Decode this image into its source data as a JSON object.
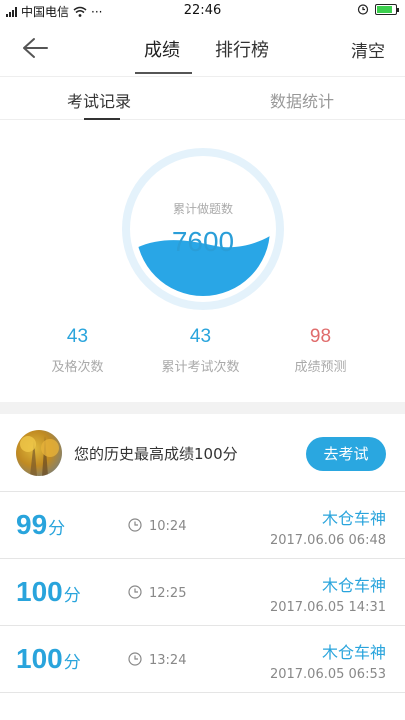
{
  "status_bar": {
    "carrier": "中国电信",
    "time": "22:46"
  },
  "nav": {
    "tabs": [
      "成绩",
      "排行榜"
    ],
    "active_tab": "成绩",
    "clear_label": "清空"
  },
  "subtabs": {
    "items": [
      "考试记录",
      "数据统计"
    ],
    "active": "考试记录"
  },
  "gauge": {
    "label": "累计做题数",
    "value": "7600",
    "accent": "#2a9ed8"
  },
  "stats": [
    {
      "value": "43",
      "caption": "及格次数"
    },
    {
      "value": "43",
      "caption": "累计考试次数"
    },
    {
      "value": "98",
      "caption": "成绩预测"
    }
  ],
  "best": {
    "text": "您的历史最高成绩100分",
    "button": "去考试"
  },
  "records": [
    {
      "score": "99",
      "unit": "分",
      "duration": "10:24",
      "name": "木仓车神",
      "date": "2017.06.06  06:48"
    },
    {
      "score": "100",
      "unit": "分",
      "duration": "12:25",
      "name": "木仓车神",
      "date": "2017.06.05  14:31"
    },
    {
      "score": "100",
      "unit": "分",
      "duration": "13:24",
      "name": "木仓车神",
      "date": "2017.06.05  06:53"
    }
  ],
  "colors": {
    "accent": "#2aa7e0",
    "prediction": "#e06c6c"
  }
}
